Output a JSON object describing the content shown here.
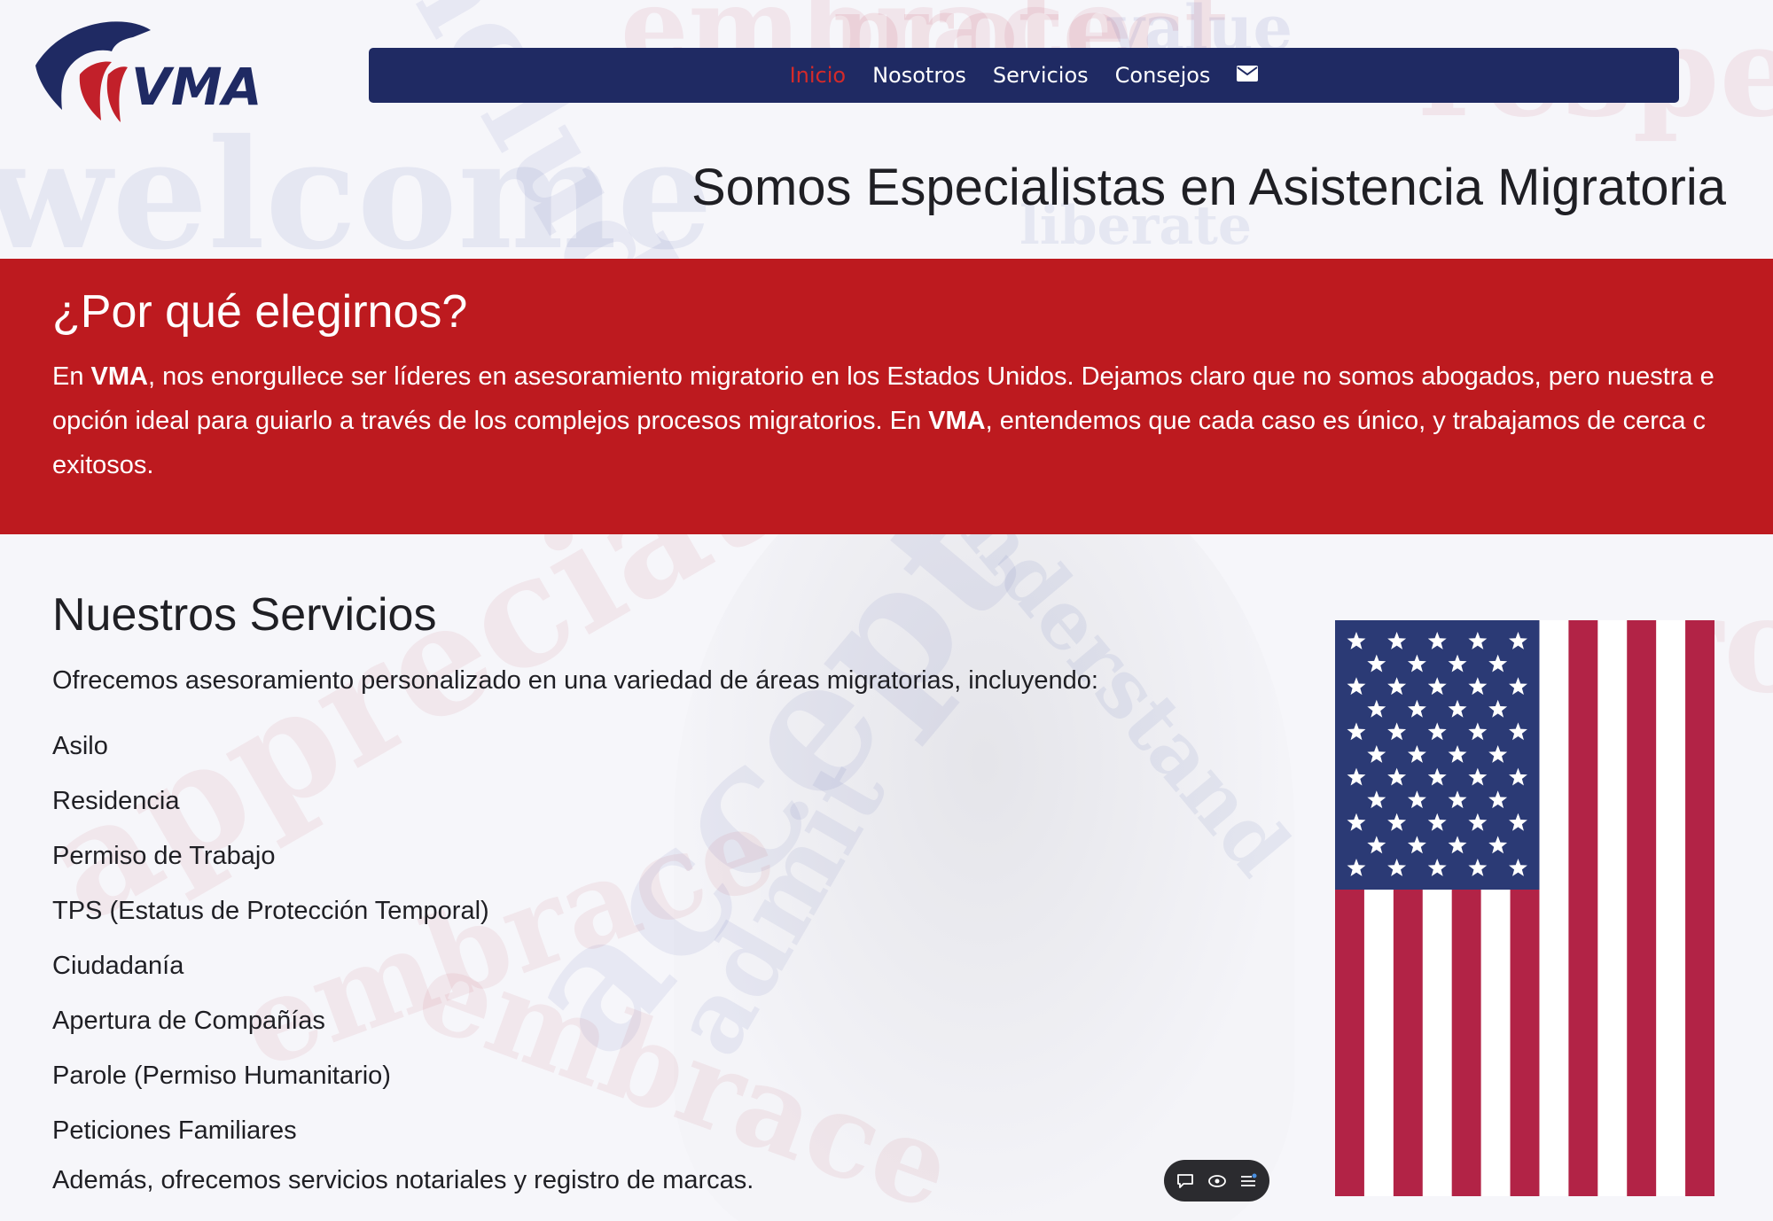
{
  "brand": {
    "logo_text": "VMA"
  },
  "nav": {
    "items": [
      {
        "label": "Inicio",
        "active": true
      },
      {
        "label": "Nosotros",
        "active": false
      },
      {
        "label": "Servicios",
        "active": false
      },
      {
        "label": "Consejos",
        "active": false
      }
    ],
    "mail_icon": "envelope-icon"
  },
  "hero": {
    "title": "Somos Especialistas en Asistencia Migratoria"
  },
  "why": {
    "heading": "¿Por qué elegirnos?",
    "line1_pre": "En ",
    "line1_bold": "VMA",
    "line1_post": ", nos enorgullece ser líderes en asesoramiento migratorio en los Estados Unidos. Dejamos claro que no somos abogados, pero nuestra e",
    "line2_pre": "opción ideal para guiarlo a través de los complejos procesos migratorios. En ",
    "line2_bold": "VMA",
    "line2_post": ", entendemos que cada caso es único, y trabajamos de cerca c",
    "line3": "exitosos."
  },
  "services": {
    "heading": "Nuestros Servicios",
    "intro": "Ofrecemos asesoramiento personalizado en una variedad de áreas migratorias, incluyendo:",
    "items": [
      "Asilo",
      "Residencia",
      "Permiso de Trabajo",
      "TPS (Estatus de Protección Temporal)",
      "Ciudadanía",
      "Apertura de Compañías",
      "Parole (Permiso Humanitario)",
      "Peticiones Familiares"
    ],
    "extra": "Además, ofrecemos servicios notariales y registro de marcas."
  },
  "widget": {
    "icons": [
      "chat-icon",
      "eye-icon",
      "list-icon"
    ]
  },
  "colors": {
    "navy": "#1f2a63",
    "red": "#bd1a1f",
    "active_nav": "#d42a2a",
    "flag_red": "#b22346",
    "flag_blue": "#2b3a75"
  }
}
